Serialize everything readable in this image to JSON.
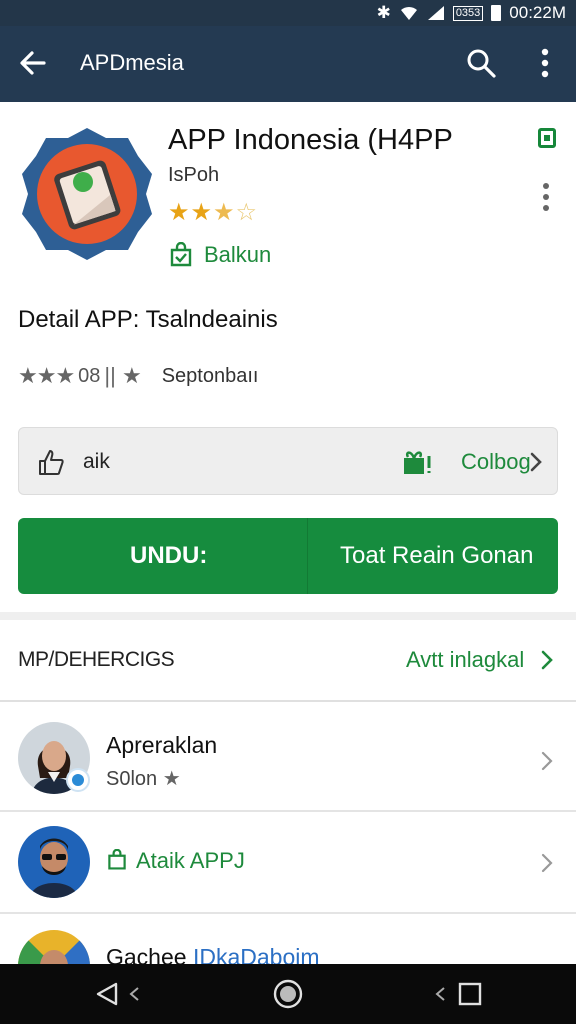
{
  "status_bar": {
    "time": "00:22M",
    "battery": "0353"
  },
  "app_bar": {
    "title": "APDmesia"
  },
  "app": {
    "name": "APP Indonesia (H4PP",
    "developer": "IsPoh",
    "rating_stars": 2.5,
    "installed_label": "Balkun",
    "detail_title": "Detail APP: Tsalndeainis",
    "rating_number": "08",
    "rating_date": "Septonbaıı"
  },
  "actions": {
    "like_label": "aik",
    "wishlist_label": "Colbog"
  },
  "install_button": {
    "left_label": "UNDU:",
    "right_label": "Toat Reain Gonan"
  },
  "section": {
    "title": "MP/DEHERCIGS",
    "link_label": "Avtt inlagkal"
  },
  "list": [
    {
      "name": "Apreraklan",
      "sub": "S0lon"
    },
    {
      "name": "",
      "sub": "Ataik APPJ"
    },
    {
      "name": "Gachee",
      "sub": "IDkaDaboim"
    }
  ],
  "colors": {
    "app_bar": "#243a52",
    "accent_green": "#168c3e",
    "star": "#e8a316"
  }
}
